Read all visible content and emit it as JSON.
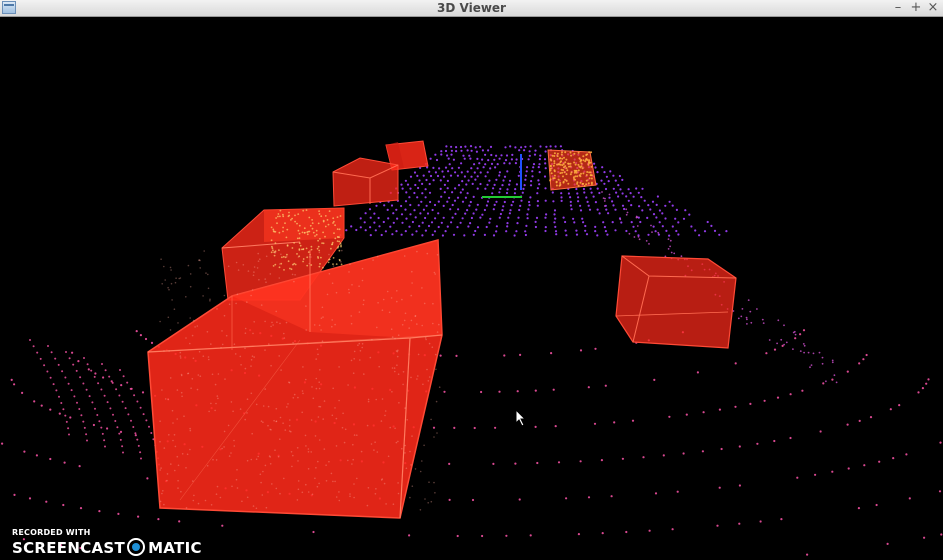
{
  "window": {
    "title": "3D Viewer",
    "controls": {
      "minimize": "–",
      "maximize": "+",
      "close": "×"
    }
  },
  "icons": {
    "app": "window-menu-icon",
    "cursor": "mouse-pointer-icon",
    "watermark_logo": "screencast-logo-icon"
  },
  "colors": {
    "background": "#000000",
    "bounding_box_fill": "#ff2a1a",
    "bounding_box_edge": "#ff4a36",
    "point_cloud_near": "#ff55aa",
    "point_cloud_far": "#a040ff",
    "axis_green": "#22cc33",
    "axis_blue": "#2050ff"
  },
  "watermark": {
    "line1": "RECORDED WITH",
    "line2a": "SCREENCAST",
    "line2b": "MATIC"
  }
}
